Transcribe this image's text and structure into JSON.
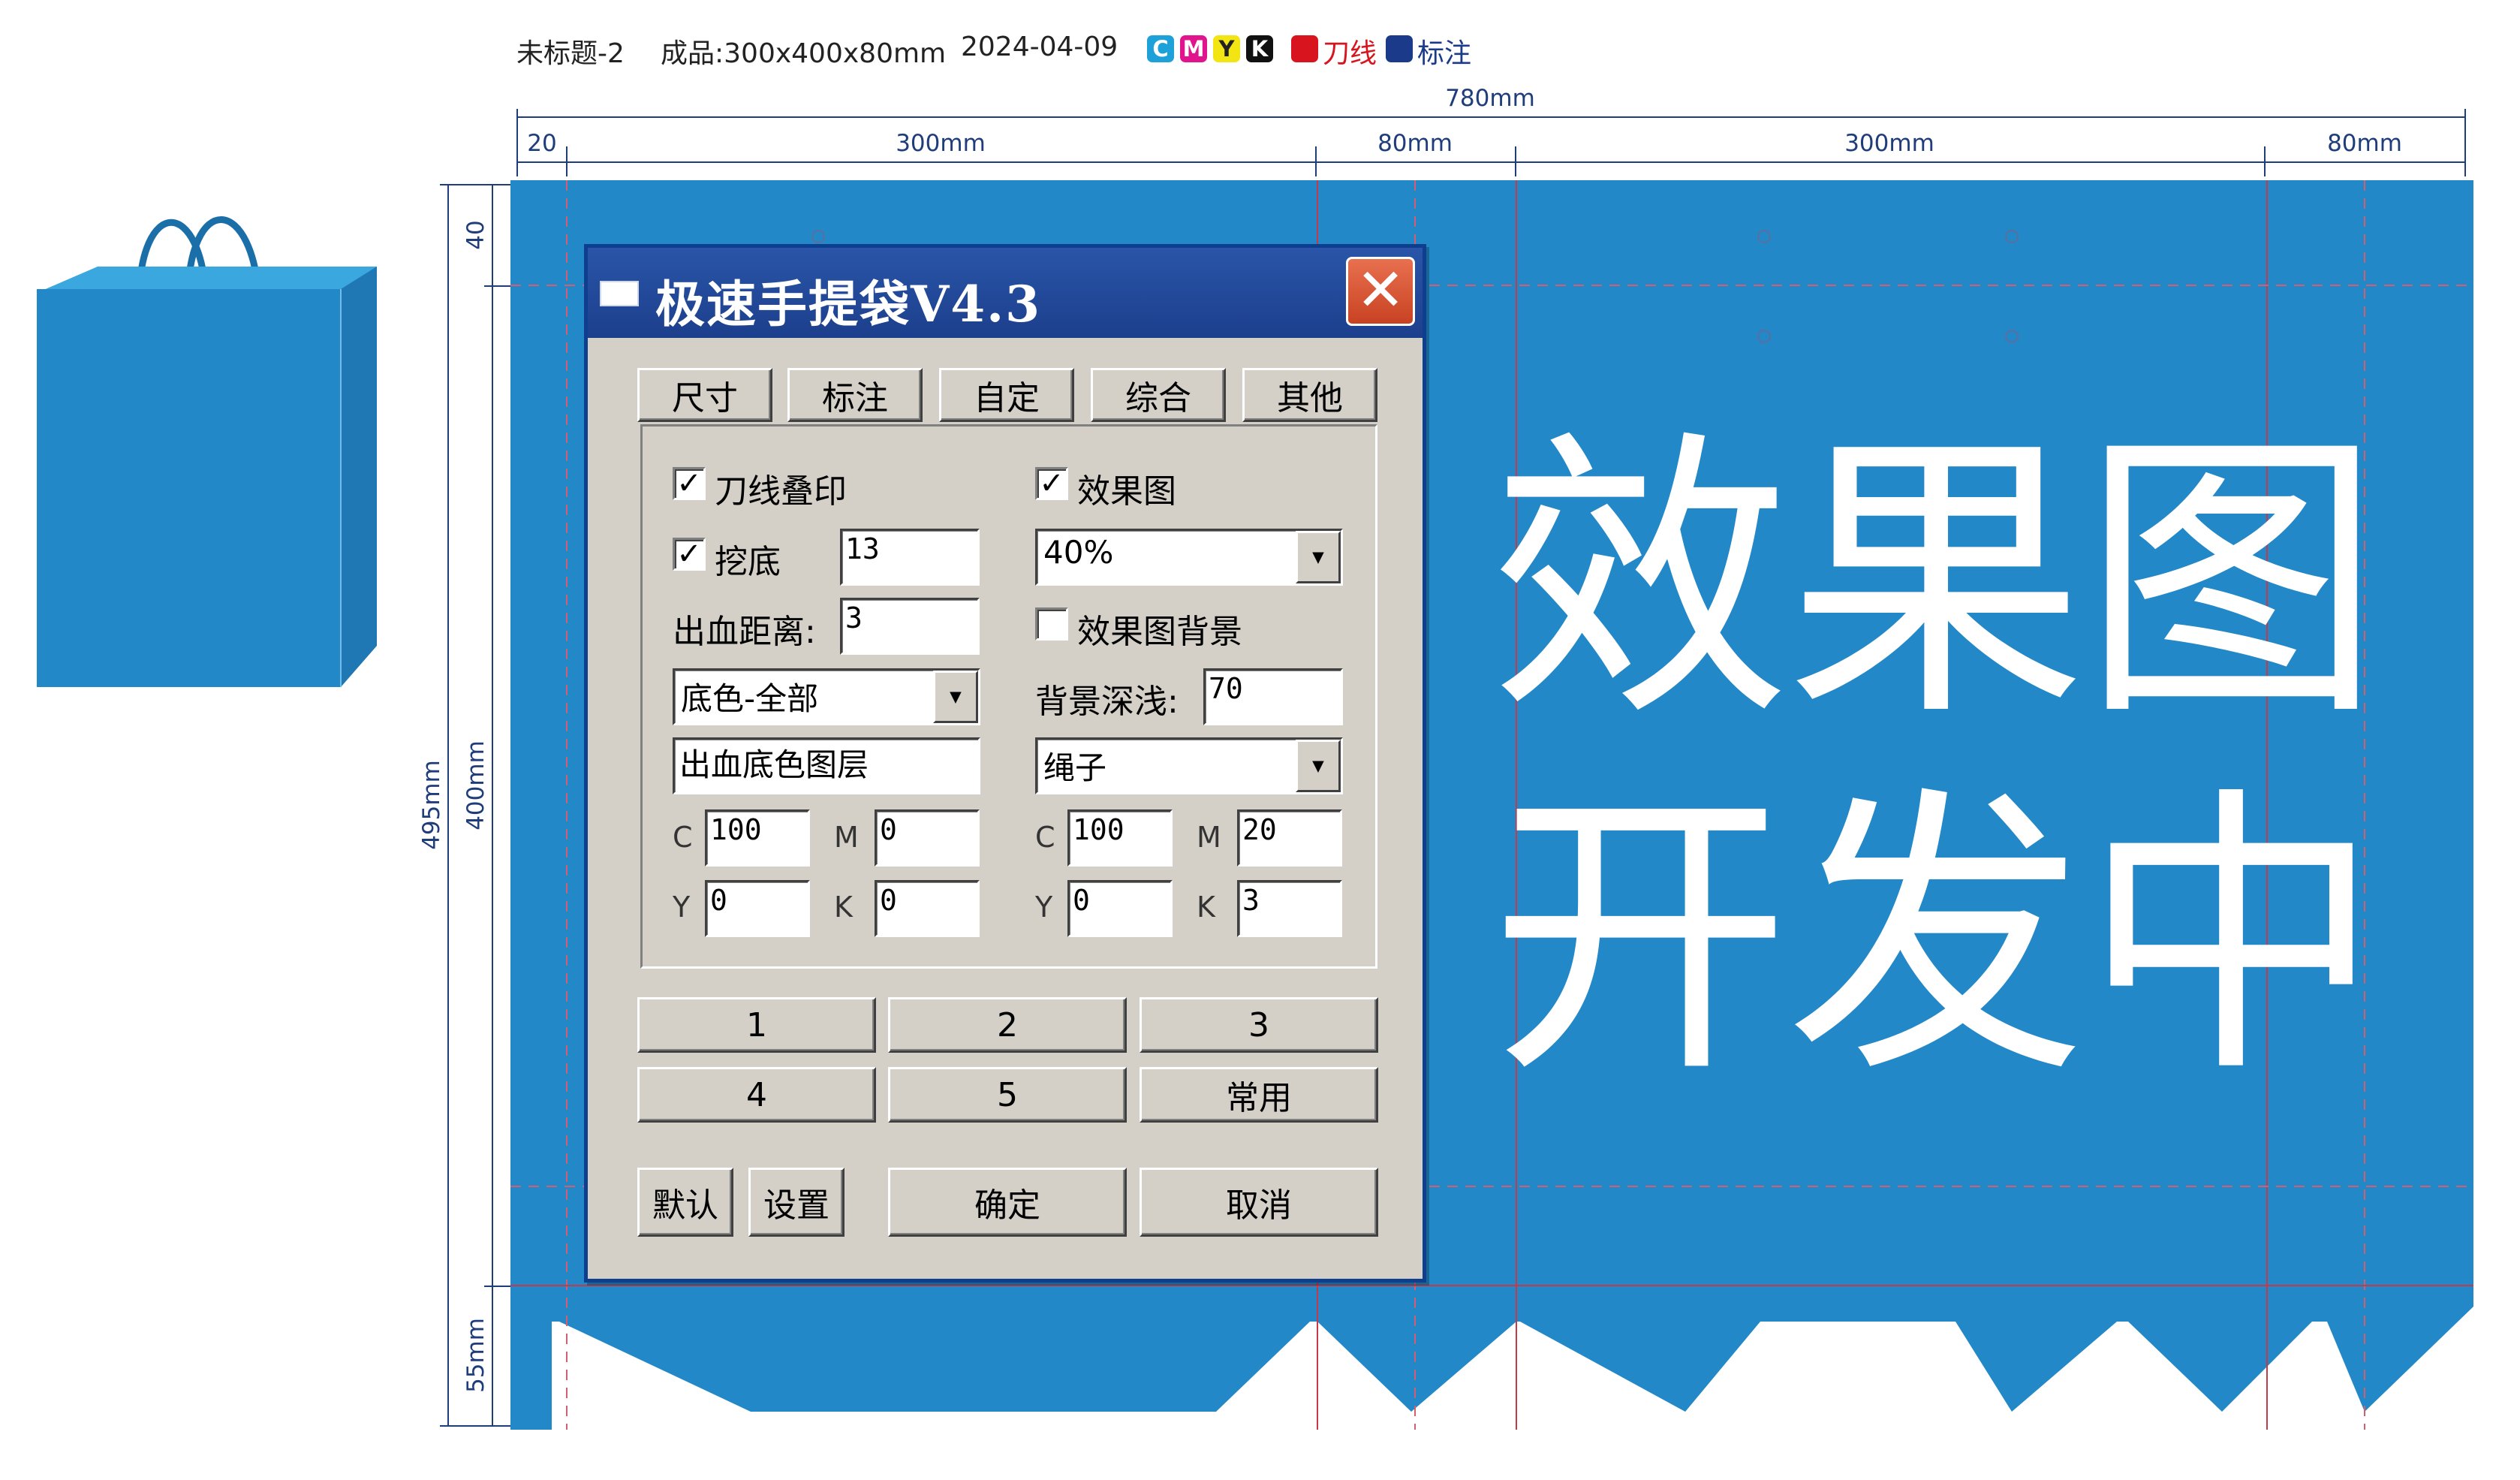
{
  "header": {
    "doc_title": "未标题-2",
    "spec": "成品:300x400x80mm",
    "date": "2024-04-09",
    "cmyk": [
      {
        "letter": "C",
        "color": "#1ea0d8"
      },
      {
        "letter": "M",
        "color": "#e0148c"
      },
      {
        "letter": "Y",
        "color": "#f3e414"
      },
      {
        "letter": "K",
        "color": "#111111"
      }
    ],
    "legend_knife_label": "刀线",
    "legend_knife_color": "#d8141e",
    "legend_note_label": "标注",
    "legend_note_color": "#1b3a8a"
  },
  "dimensions": {
    "total_width": "780mm",
    "top_segments": [
      "20",
      "300mm",
      "80mm",
      "300mm",
      "80mm"
    ],
    "left_total": "495mm",
    "left_top": "40",
    "left_body": "400mm",
    "left_bottom": "55mm"
  },
  "artwork": {
    "bag_color": "#2288c8",
    "big_text_line1": "效果图",
    "big_text_line2": "开发中"
  },
  "dialog": {
    "title": "极速手提袋V4.3",
    "close_glyph": "✕",
    "tabs": [
      "尺寸",
      "标注",
      "自定",
      "综合",
      "其他"
    ],
    "options": {
      "knife_overprint": {
        "label": "刀线叠印",
        "checked": true
      },
      "effect_image": {
        "label": "效果图",
        "checked": true
      },
      "dig_bottom": {
        "label": "挖底",
        "checked": true,
        "value": "13"
      },
      "effect_scale": "40%",
      "bleed_label": "出血距离:",
      "bleed_value": "3",
      "effect_bg": {
        "label": "效果图背景",
        "checked": false
      },
      "base_color_mode": "底色-全部",
      "bg_depth_label": "背景深浅:",
      "bg_depth_value": "70",
      "bleed_layer_value": "出血底色图层",
      "rope": "绳子",
      "left_cmyk": {
        "C": "100",
        "M": "0",
        "Y": "0",
        "K": "0"
      },
      "right_cmyk": {
        "C": "100",
        "M": "20",
        "Y": "0",
        "K": "3"
      },
      "cmyk_labels": {
        "C": "C",
        "M": "M",
        "Y": "Y",
        "K": "K"
      }
    },
    "presets": [
      "1",
      "2",
      "3",
      "4",
      "5",
      "常用"
    ],
    "footer": {
      "default": "默认",
      "settings": "设置",
      "ok": "确定",
      "cancel": "取消"
    }
  }
}
